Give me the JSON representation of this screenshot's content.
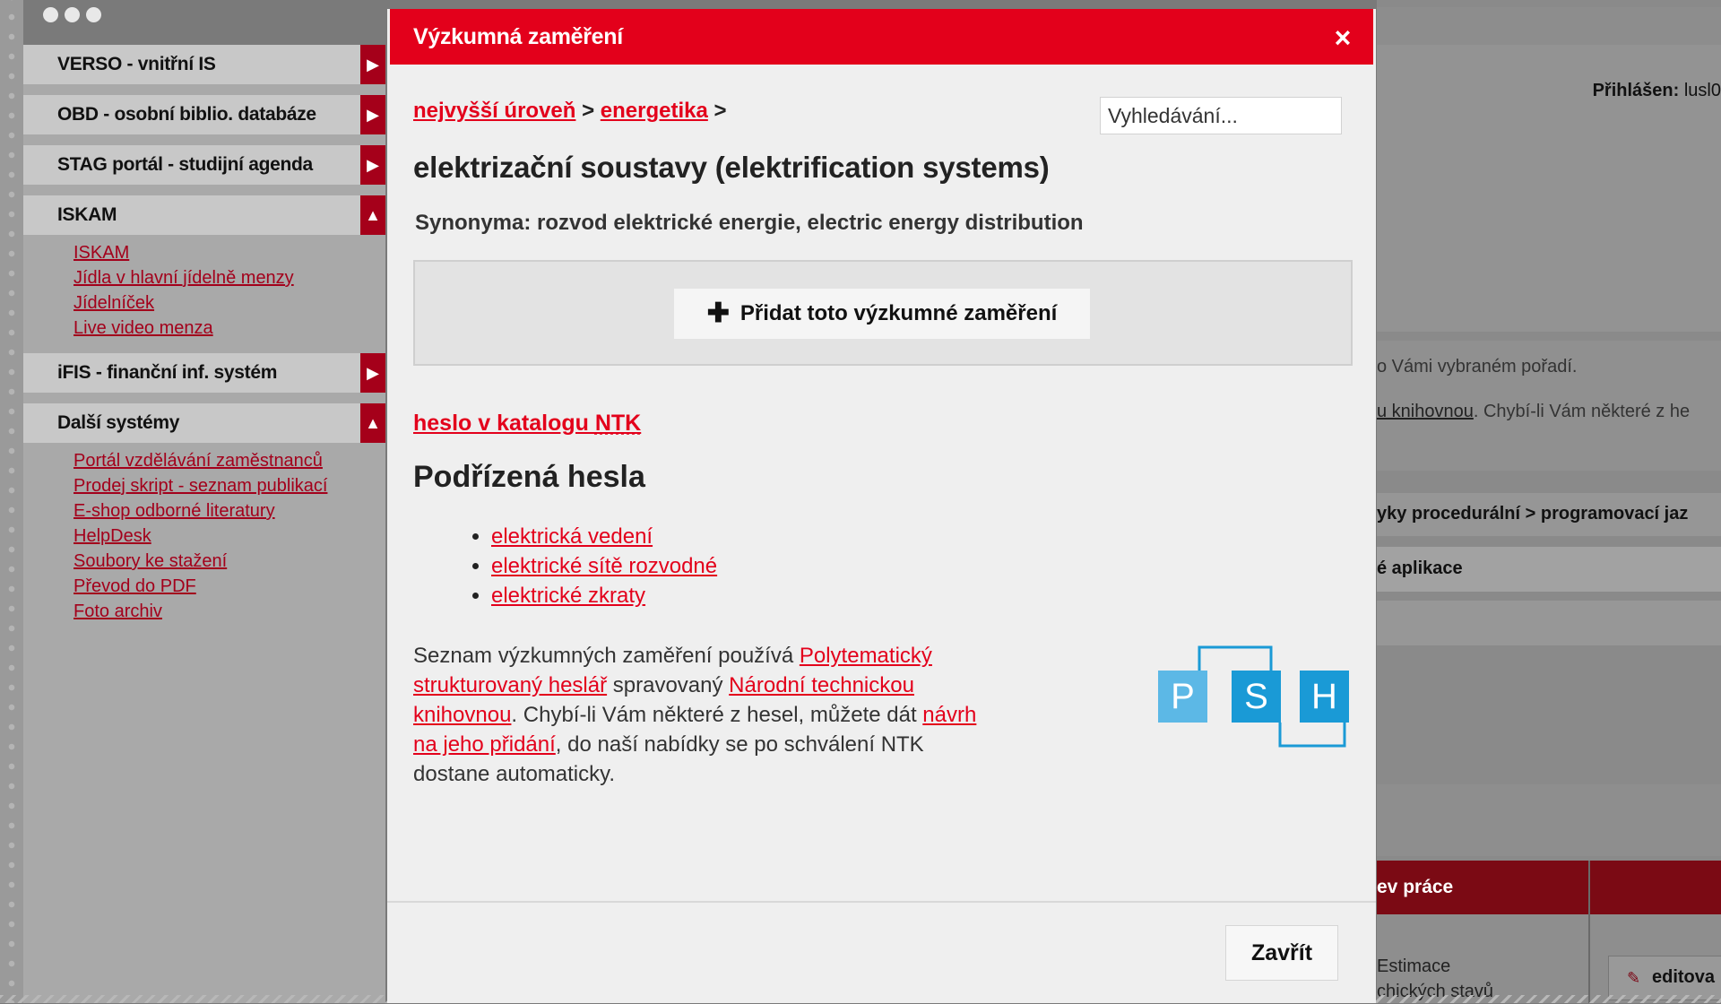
{
  "sidebar": {
    "menus": [
      {
        "label": "VERSO - vnitřní IS",
        "state": "collapsed"
      },
      {
        "label": "OBD - osobní biblio. databáze",
        "state": "collapsed"
      },
      {
        "label": "STAG portál - studijní agenda",
        "state": "collapsed"
      },
      {
        "label": "ISKAM",
        "state": "expanded",
        "items": [
          "ISKAM",
          "Jídla v hlavní jídelně menzy",
          "Jídelníček",
          "Live video menza"
        ]
      },
      {
        "label": "iFIS - finanční inf. systém",
        "state": "collapsed"
      },
      {
        "label": "Další systémy",
        "state": "expanded",
        "items": [
          "Portál vzdělávání zaměstnanců",
          "Prodej skript - seznam publikací",
          "E-shop odborné literatury",
          "HelpDesk",
          "Soubory ke stažení",
          "Převod do PDF",
          "Foto archiv"
        ]
      }
    ]
  },
  "background": {
    "login_label": "Přihlášen:",
    "login_user": "lusl0",
    "text1": "o Vámi vybraném pořadí.",
    "text2_link": "u knihovnou",
    "text2_rest": ". Chybí-li Vám některé z he",
    "path": "yky procedurální > programovací jaz",
    "row": "é aplikace",
    "table_header": "ev práce",
    "cell_line1": "Estimace",
    "cell_line2": "chických stavů",
    "edit_label": "editova"
  },
  "modal": {
    "title": "Výzkumná zaměření",
    "close_glyph": "×",
    "breadcrumb": {
      "level1": "nejvyšší úroveň",
      "sep": ">",
      "level2": "energetika"
    },
    "search_placeholder": "Vyhledávání...",
    "heading": "elektrizační soustavy (elektrification systems)",
    "synonyms": "Synonyma: rozvod elektrické energie, electric energy distribution",
    "add_button": "Přidat toto výzkumné zaměření",
    "catalog_link_pre": "heslo v katalogu ",
    "catalog_link_abbr": "NTK",
    "subheading": "Podřízená hesla",
    "children": [
      "elektrická vedení",
      "elektrické sítě rozvodné",
      "elektrické zkraty"
    ],
    "info": {
      "t1": "Seznam výzkumných zaměření používá ",
      "l1": "Polytematický strukturovaný heslář",
      "t2": " spravovaný ",
      "l2": "Národní technickou knihovnou",
      "t3": ". Chybí-li Vám některé z hesel, můžete dát ",
      "l3": "návrh na jeho přidání",
      "t4": ", do naší nabídky se po schválení NTK dostane automaticky."
    },
    "logo_letters": [
      "P",
      "S",
      "H"
    ],
    "close_button": "Zavřít"
  },
  "colors": {
    "accent": "#e3001b",
    "logo_blue": "#1a9ad6",
    "logo_light": "#5cb8e6"
  },
  "icons": {
    "close": "close-icon",
    "add": "plus-icon",
    "edit": "pencil-icon"
  }
}
